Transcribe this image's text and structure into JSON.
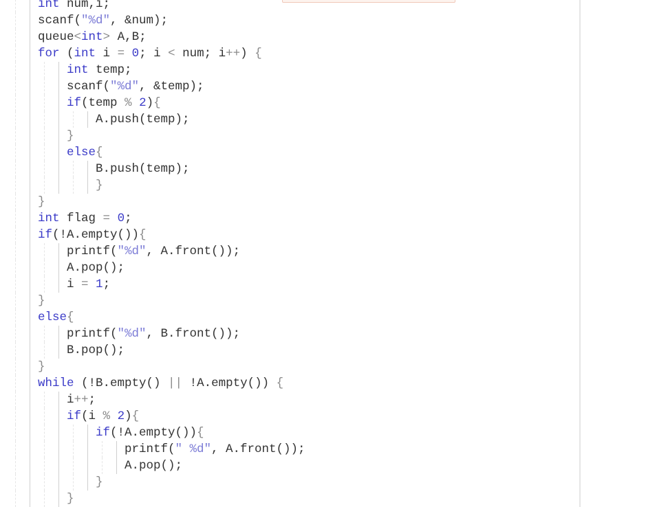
{
  "editor": {
    "colors": {
      "keyword": "#3b3bc8",
      "string": "#7b7bd6",
      "punct": "#8a8a8a",
      "text": "#333333"
    },
    "lines": [
      {
        "indent": 0,
        "tokens": [
          [
            "k",
            "int"
          ],
          [
            "t",
            " num,i;"
          ]
        ]
      },
      {
        "indent": 0,
        "tokens": [
          [
            "t",
            "scanf("
          ],
          [
            "s",
            "\"%d\""
          ],
          [
            "t",
            ", &num);"
          ]
        ]
      },
      {
        "indent": 0,
        "tokens": [
          [
            "t",
            "queue"
          ],
          [
            "p",
            "<"
          ],
          [
            "k",
            "int"
          ],
          [
            "p",
            ">"
          ],
          [
            "t",
            " A,B;"
          ]
        ]
      },
      {
        "indent": 0,
        "tokens": [
          [
            "k",
            "for"
          ],
          [
            "t",
            " ("
          ],
          [
            "k",
            "int"
          ],
          [
            "t",
            " i "
          ],
          [
            "p",
            "="
          ],
          [
            "t",
            " "
          ],
          [
            "n",
            "0"
          ],
          [
            "t",
            "; i "
          ],
          [
            "p",
            "<"
          ],
          [
            "t",
            " num; i"
          ],
          [
            "p",
            "++"
          ],
          [
            "t",
            ") "
          ],
          [
            "p",
            "{"
          ]
        ]
      },
      {
        "indent": 1,
        "tokens": [
          [
            "k",
            "int"
          ],
          [
            "t",
            " temp;"
          ]
        ]
      },
      {
        "indent": 1,
        "tokens": [
          [
            "t",
            "scanf("
          ],
          [
            "s",
            "\"%d\""
          ],
          [
            "t",
            ", &temp);"
          ]
        ]
      },
      {
        "indent": 1,
        "tokens": [
          [
            "k",
            "if"
          ],
          [
            "t",
            "(temp "
          ],
          [
            "p",
            "%"
          ],
          [
            "t",
            " "
          ],
          [
            "n",
            "2"
          ],
          [
            "t",
            ")"
          ],
          [
            "p",
            "{"
          ]
        ]
      },
      {
        "indent": 2,
        "tokens": [
          [
            "t",
            "A.push(temp);"
          ]
        ]
      },
      {
        "indent": 1,
        "tokens": [
          [
            "p",
            "}"
          ]
        ]
      },
      {
        "indent": 1,
        "tokens": [
          [
            "k",
            "else"
          ],
          [
            "p",
            "{"
          ]
        ]
      },
      {
        "indent": 2,
        "tokens": [
          [
            "t",
            "B.push(temp);"
          ]
        ]
      },
      {
        "indent": 2,
        "tokens": [
          [
            "p",
            "}"
          ]
        ]
      },
      {
        "indent": 0,
        "tokens": [
          [
            "p",
            "}"
          ]
        ]
      },
      {
        "indent": 0,
        "tokens": [
          [
            "k",
            "int"
          ],
          [
            "t",
            " flag "
          ],
          [
            "p",
            "="
          ],
          [
            "t",
            " "
          ],
          [
            "n",
            "0"
          ],
          [
            "t",
            ";"
          ]
        ]
      },
      {
        "indent": 0,
        "tokens": [
          [
            "k",
            "if"
          ],
          [
            "t",
            "(!A.empty())"
          ],
          [
            "p",
            "{"
          ]
        ]
      },
      {
        "indent": 1,
        "tokens": [
          [
            "t",
            "printf("
          ],
          [
            "s",
            "\"%d\""
          ],
          [
            "t",
            ", A.front());"
          ]
        ]
      },
      {
        "indent": 1,
        "tokens": [
          [
            "t",
            "A.pop();"
          ]
        ]
      },
      {
        "indent": 1,
        "tokens": [
          [
            "t",
            "i "
          ],
          [
            "p",
            "="
          ],
          [
            "t",
            " "
          ],
          [
            "n",
            "1"
          ],
          [
            "t",
            ";"
          ]
        ]
      },
      {
        "indent": 0,
        "tokens": [
          [
            "p",
            "}"
          ]
        ]
      },
      {
        "indent": 0,
        "tokens": [
          [
            "k",
            "else"
          ],
          [
            "p",
            "{"
          ]
        ]
      },
      {
        "indent": 1,
        "tokens": [
          [
            "t",
            "printf("
          ],
          [
            "s",
            "\"%d\""
          ],
          [
            "t",
            ", B.front());"
          ]
        ]
      },
      {
        "indent": 1,
        "tokens": [
          [
            "t",
            "B.pop();"
          ]
        ]
      },
      {
        "indent": 0,
        "tokens": [
          [
            "p",
            "}"
          ]
        ]
      },
      {
        "indent": 0,
        "tokens": [
          [
            "k",
            "while"
          ],
          [
            "t",
            " (!B.empty() "
          ],
          [
            "p",
            "||"
          ],
          [
            "t",
            " !A.empty()) "
          ],
          [
            "p",
            "{"
          ]
        ]
      },
      {
        "indent": 1,
        "tokens": [
          [
            "t",
            "i"
          ],
          [
            "p",
            "++"
          ],
          [
            "t",
            ";"
          ]
        ]
      },
      {
        "indent": 1,
        "tokens": [
          [
            "k",
            "if"
          ],
          [
            "t",
            "(i "
          ],
          [
            "p",
            "%"
          ],
          [
            "t",
            " "
          ],
          [
            "n",
            "2"
          ],
          [
            "t",
            ")"
          ],
          [
            "p",
            "{"
          ]
        ]
      },
      {
        "indent": 2,
        "tokens": [
          [
            "k",
            "if"
          ],
          [
            "t",
            "(!A.empty())"
          ],
          [
            "p",
            "{"
          ]
        ]
      },
      {
        "indent": 3,
        "tokens": [
          [
            "t",
            "printf("
          ],
          [
            "s",
            "\" %d\""
          ],
          [
            "t",
            ", A.front());"
          ]
        ]
      },
      {
        "indent": 3,
        "tokens": [
          [
            "t",
            "A.pop();"
          ]
        ]
      },
      {
        "indent": 2,
        "tokens": [
          [
            "p",
            "}"
          ]
        ]
      },
      {
        "indent": 1,
        "tokens": [
          [
            "p",
            "}"
          ]
        ]
      }
    ]
  }
}
